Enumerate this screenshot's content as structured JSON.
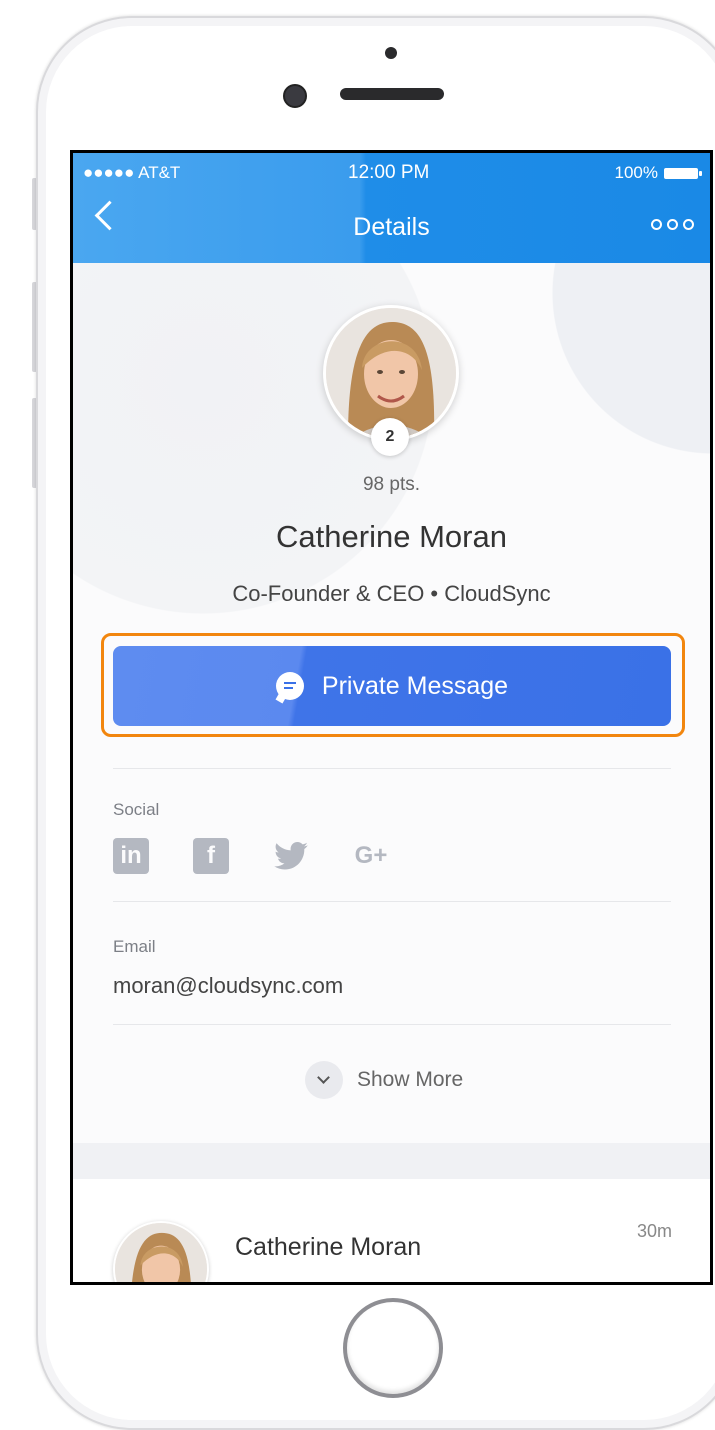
{
  "status_bar": {
    "carrier": "●●●●● AT&T",
    "time": "12:00 PM",
    "battery": "100%"
  },
  "nav": {
    "title": "Details"
  },
  "profile": {
    "rank": "2",
    "points": "98 pts.",
    "name": "Catherine Moran",
    "role": "Co-Founder & CEO  •  CloudSync"
  },
  "actions": {
    "private_message": "Private Message"
  },
  "social": {
    "label": "Social",
    "icons": [
      "linkedin-icon",
      "facebook-icon",
      "twitter-icon",
      "google-plus-icon"
    ],
    "linkedin_glyph": "in",
    "facebook_glyph": "f",
    "google_glyph": "G+"
  },
  "email": {
    "label": "Email",
    "value": "moran@cloudsync.com"
  },
  "show_more": {
    "label": "Show More"
  },
  "feed": {
    "name": "Catherine Moran",
    "time": "30m"
  },
  "colors": {
    "nav_blue": "#1f8de8",
    "button_blue": "#3a71e7",
    "highlight_orange": "#f2860e"
  }
}
